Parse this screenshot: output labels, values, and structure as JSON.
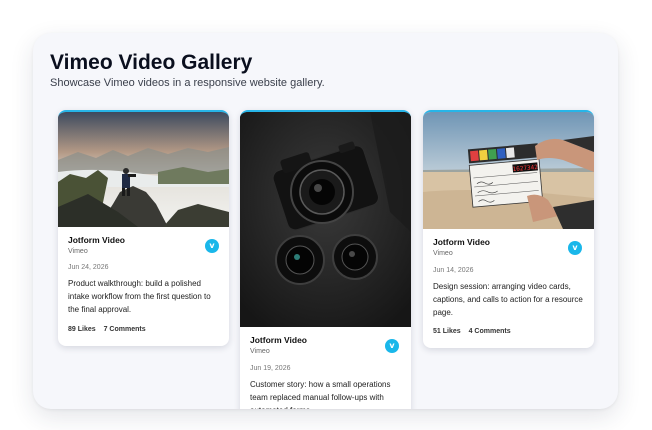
{
  "header": {
    "title": "Vimeo Video Gallery",
    "subtitle": "Showcase Vimeo videos in a responsive website gallery."
  },
  "cards": [
    {
      "author": "Jotform Video",
      "source": "Vimeo",
      "date": "Jun 24, 2026",
      "description": "Product walkthrough: build a polished intake workflow from the first question to the final approval.",
      "likes": "89 Likes",
      "comments": "7 Comments",
      "badge_icon": "vimeo-icon"
    },
    {
      "author": "Jotform Video",
      "source": "Vimeo",
      "date": "Jun 19, 2026",
      "description": "Customer story: how a small operations team replaced manual follow-ups with automated forms.",
      "badge_icon": "vimeo-icon"
    },
    {
      "author": "Jotform Video",
      "source": "Vimeo",
      "date": "Jun 14, 2026",
      "description": "Design session: arranging video cards, captions, and calls to action for a resource page.",
      "likes": "51 Likes",
      "comments": "4 Comments",
      "badge_icon": "vimeo-icon",
      "clapper_display": "1627342"
    }
  ],
  "colors": {
    "accent": "#27b5e8",
    "vimeo_badge": "#1ab7ea"
  }
}
